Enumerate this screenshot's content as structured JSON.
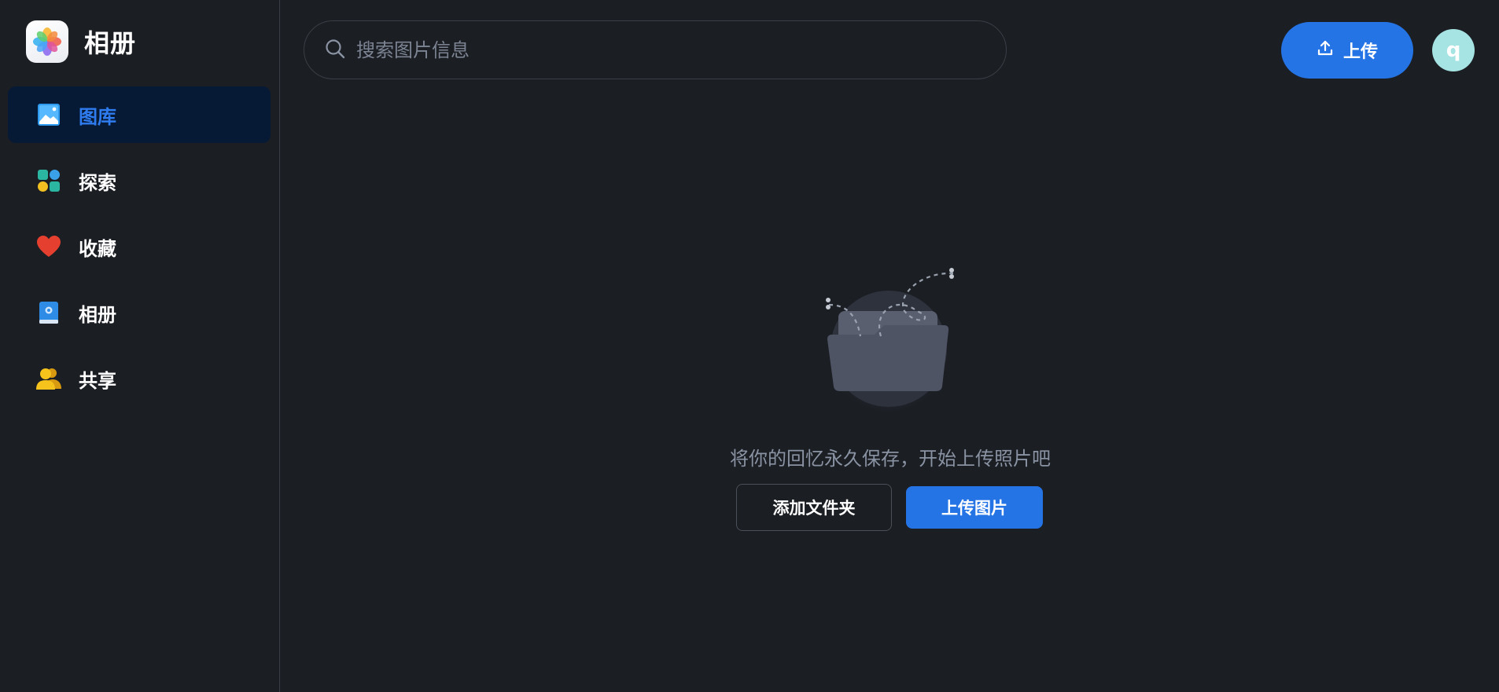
{
  "app": {
    "title": "相册",
    "logo_icon": "photos-flower-icon"
  },
  "sidebar": {
    "items": [
      {
        "label": "图库",
        "icon": "gallery-image-icon",
        "active": true
      },
      {
        "label": "探索",
        "icon": "explore-grid-icon",
        "active": false
      },
      {
        "label": "收藏",
        "icon": "heart-icon",
        "active": false
      },
      {
        "label": "相册",
        "icon": "album-book-icon",
        "active": false
      },
      {
        "label": "共享",
        "icon": "shared-users-icon",
        "active": false
      }
    ]
  },
  "header": {
    "search_placeholder": "搜索图片信息",
    "upload_label": "上传",
    "avatar_initial": "q"
  },
  "empty_state": {
    "message": "将你的回忆永久保存，开始上传照片吧",
    "add_folder_label": "添加文件夹",
    "upload_photos_label": "上传图片"
  },
  "colors": {
    "accent": "#2574e6",
    "active_nav_bg": "#061a36",
    "background": "#1b1e23",
    "avatar_bg": "#a6e4e3"
  }
}
